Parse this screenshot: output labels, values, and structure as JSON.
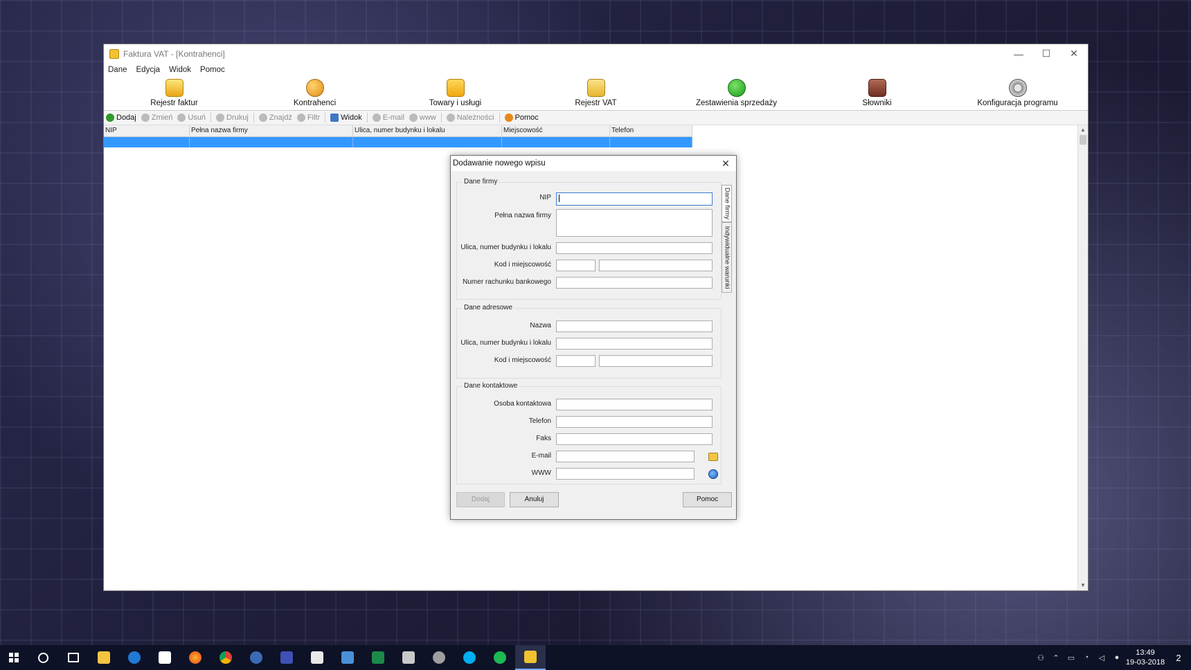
{
  "window": {
    "title": "Faktura VAT - [Kontrahenci]",
    "minimize_glyph": "—",
    "maximize_glyph": "☐",
    "close_glyph": "✕"
  },
  "menu": [
    "Dane",
    "Edycja",
    "Widok",
    "Pomoc"
  ],
  "toolbar_main": [
    {
      "label": "Rejestr faktur",
      "icon": "invoice-register-icon"
    },
    {
      "label": "Kontrahenci",
      "icon": "contractors-icon"
    },
    {
      "label": "Towary i usługi",
      "icon": "goods-folder-icon"
    },
    {
      "label": "Rejestr VAT",
      "icon": "vat-register-icon"
    },
    {
      "label": "Zestawienia sprzedaży",
      "icon": "sales-chart-icon"
    },
    {
      "label": "Słowniki",
      "icon": "dictionary-book-icon"
    },
    {
      "label": "Konfiguracja programu",
      "icon": "configuration-icon"
    }
  ],
  "toolbar_actions": {
    "add": "Dodaj",
    "edit": "Zmień",
    "delete": "Usuń",
    "print": "Drukuj",
    "find": "Znajdź",
    "filter": "Filtr",
    "view": "Widok",
    "email": "E-mail",
    "www": "www",
    "dues": "Należności",
    "help": "Pomoc"
  },
  "grid": {
    "columns": [
      "NIP",
      "Pełna nazwa firmy",
      "Ulica, numer budynku i lokalu",
      "Miejscowość",
      "Telefon"
    ]
  },
  "dialog": {
    "title": "Dodawanie nowego wpisu",
    "close_glyph": "✕",
    "company_group": {
      "title": "Dane firmy",
      "nip_label": "NIP",
      "fullname_label": "Pełna nazwa firmy",
      "street_label": "Ulica, numer budynku i lokalu",
      "postal_label": "Kod i miejscowość",
      "bank_label": "Numer rachunku bankowego"
    },
    "address_group": {
      "title": "Dane adresowe",
      "name_label": "Nazwa",
      "street_label": "Ulica, numer budynku i lokalu",
      "postal_label": "Kod i miejscowość"
    },
    "contact_group": {
      "title": "Dane kontaktowe",
      "person_label": "Osoba kontaktowa",
      "phone_label": "Telefon",
      "fax_label": "Faks",
      "email_label": "E-mail",
      "www_label": "WWW"
    },
    "tabs": [
      "Dane firmy",
      "Indywidualne warunki"
    ],
    "buttons": {
      "add": "Dodaj",
      "cancel": "Anuluj",
      "help": "Pomoc"
    }
  },
  "taskbar": {
    "time": "13:49",
    "date": "19-03-2018",
    "notifications": "2"
  }
}
